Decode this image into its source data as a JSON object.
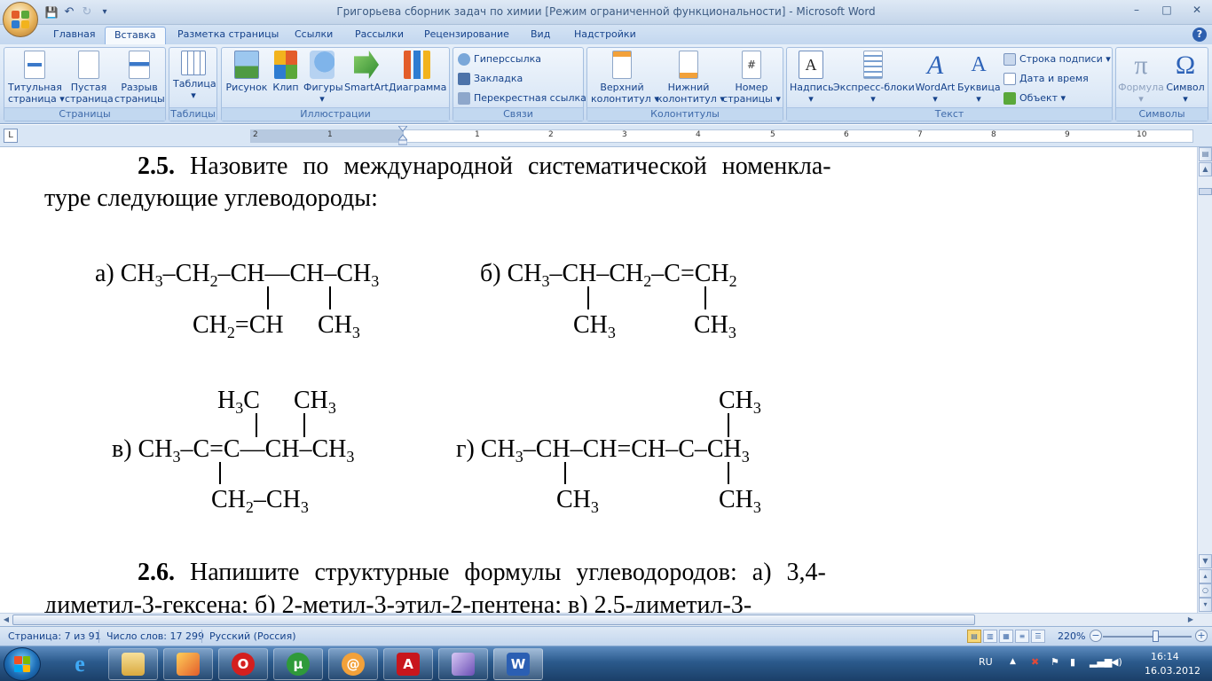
{
  "window": {
    "title": "Григорьева сборник задач по химии [Режим ограниченной функциональности] - Microsoft Word",
    "minimize": "–",
    "maximize": "□",
    "close": "✕"
  },
  "qat": {
    "save": "💾",
    "undo": "↶",
    "redo": "↻",
    "customize": "▾"
  },
  "tabs": [
    "Главная",
    "Вставка",
    "Разметка страницы",
    "Ссылки",
    "Рассылки",
    "Рецензирование",
    "Вид",
    "Надстройки"
  ],
  "ribbon": {
    "pages": {
      "label": "Страницы",
      "cover": "Титульная\nстраница ▾",
      "blank": "Пустая\nстраница",
      "break": "Разрыв\nстраницы"
    },
    "tables": {
      "label": "Таблицы",
      "table": "Таблица\n▾"
    },
    "illustrations": {
      "label": "Иллюстрации",
      "picture": "Рисунок",
      "clip": "Клип",
      "shapes": "Фигуры\n▾",
      "smartart": "SmartArt",
      "chart": "Диаграмма"
    },
    "links": {
      "label": "Связи",
      "hyperlink": "Гиперссылка",
      "bookmark": "Закладка",
      "crossref": "Перекрестная ссылка"
    },
    "headers": {
      "label": "Колонтитулы",
      "header": "Верхний\nколонтитул ▾",
      "footer": "Нижний\nколонтитул ▾",
      "pagenum": "Номер\nстраницы ▾"
    },
    "text": {
      "label": "Текст",
      "textbox": "Надпись\n▾",
      "quickparts": "Экспресс-блоки\n▾",
      "wordart": "WordArt\n▾",
      "dropcap": "Буквица\n▾",
      "sigline": "Строка подписи ▾",
      "datetime": "Дата и время",
      "object": "Объект ▾"
    },
    "symbols": {
      "label": "Символы",
      "equation": "Формула\n▾",
      "symbol": "Символ\n▾"
    }
  },
  "ruler": {
    "corner": "L",
    "numbers": [
      "2",
      "1",
      "1",
      "2",
      "3",
      "4",
      "5",
      "6",
      "7",
      "8",
      "9",
      "10"
    ]
  },
  "document": {
    "p1_num": "2.5.",
    "p1_line1": " Назовите по международной систематической номенкла-",
    "p1_line2": "туре следующие углеводороды:",
    "p2_num": "2.6.",
    "p2_line1": " Напишите структурные формулы углеводородов: а) 3,4-",
    "p2_line2": "диметил-3-гексена;     б) 2-метил-3-этил-2-пентена;     в) 2,5-диметил-3-"
  },
  "status": {
    "page": "Страница: 7 из 91",
    "words": "Число слов: 17 299",
    "lang": "Русский (Россия)",
    "zoom": "220%",
    "zoom_minus": "−",
    "zoom_plus": "+"
  },
  "taskbar": {
    "lang": "RU",
    "time": "16:14",
    "date": "16.03.2012",
    "apps": [
      "internet-explorer",
      "file-explorer",
      "paint",
      "opera",
      "utorrent",
      "mail-at",
      "adobe-reader",
      "visio-like",
      "word"
    ]
  },
  "colors": {
    "ribbon_text": "#15428b",
    "group_label": "#3e6aaa",
    "taskbar": "#2b5a8c"
  }
}
